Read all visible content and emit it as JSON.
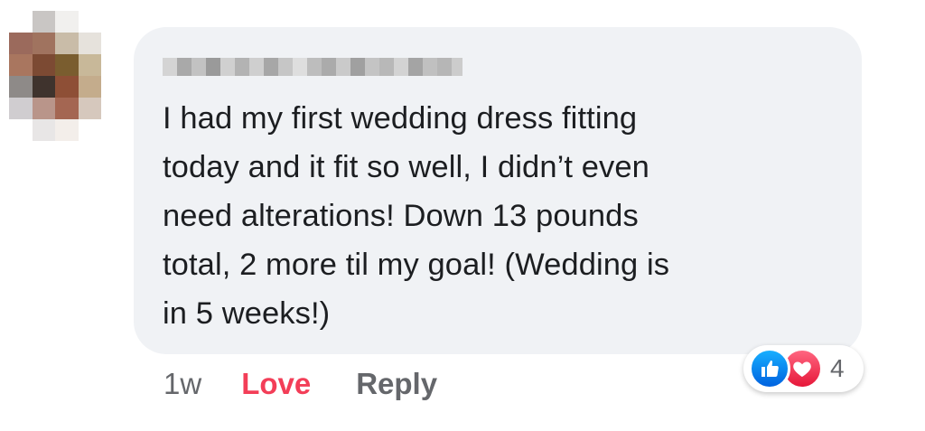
{
  "comment": {
    "text_lines": [
      "I had my first wedding dress fitting",
      "today and it fit so well, I didn’t even",
      "need alterations! Down 13 pounds",
      "total, 2 more til my goal! (Wedding is",
      "in 5 weeks!)"
    ],
    "timestamp": "1w",
    "love_label": "Love",
    "reply_label": "Reply"
  },
  "reactions": {
    "types": [
      "like-icon",
      "love-icon"
    ],
    "count": "4"
  },
  "colors": {
    "bubble": "#f0f2f5",
    "text": "#1c1e21",
    "meta": "#65676b",
    "love_accent": "#f33e58",
    "like_blue": "#0a7cff",
    "love_red": "#f33e58"
  }
}
